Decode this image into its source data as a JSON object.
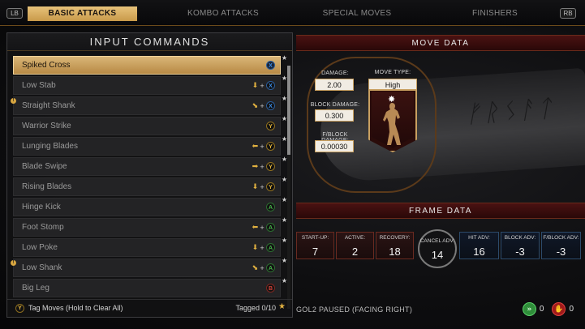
{
  "header": {
    "lb": "LB",
    "rb": "RB",
    "tabs": [
      "BASIC ATTACKS",
      "KOMBO ATTACKS",
      "SPECIAL MOVES",
      "FINISHERS"
    ]
  },
  "input_commands": {
    "title": "INPUT COMMANDS",
    "moves": [
      {
        "name": "Spiked Cross",
        "selected": true,
        "tagged": false,
        "cmd": {
          "arrow": "",
          "button": "X",
          "color": "x"
        }
      },
      {
        "name": "Low Stab",
        "selected": false,
        "tagged": false,
        "cmd": {
          "arrow": "⬇",
          "button": "X",
          "color": "x"
        }
      },
      {
        "name": "Straight Shank",
        "selected": false,
        "tagged": true,
        "cmd": {
          "arrow": "⬊",
          "button": "X",
          "color": "x"
        }
      },
      {
        "name": "Warrior Strike",
        "selected": false,
        "tagged": false,
        "cmd": {
          "arrow": "",
          "button": "Y",
          "color": "y"
        }
      },
      {
        "name": "Lunging Blades",
        "selected": false,
        "tagged": false,
        "cmd": {
          "arrow": "⬅",
          "button": "Y",
          "color": "y"
        }
      },
      {
        "name": "Blade Swipe",
        "selected": false,
        "tagged": false,
        "cmd": {
          "arrow": "➡",
          "button": "Y",
          "color": "y"
        }
      },
      {
        "name": "Rising Blades",
        "selected": false,
        "tagged": false,
        "cmd": {
          "arrow": "⬇",
          "button": "Y",
          "color": "y"
        }
      },
      {
        "name": "Hinge Kick",
        "selected": false,
        "tagged": false,
        "cmd": {
          "arrow": "",
          "button": "A",
          "color": "a"
        }
      },
      {
        "name": "Foot Stomp",
        "selected": false,
        "tagged": false,
        "cmd": {
          "arrow": "⬅",
          "button": "A",
          "color": "a"
        }
      },
      {
        "name": "Low Poke",
        "selected": false,
        "tagged": false,
        "cmd": {
          "arrow": "⬇",
          "button": "A",
          "color": "a"
        }
      },
      {
        "name": "Low Shank",
        "selected": false,
        "tagged": true,
        "cmd": {
          "arrow": "⬊",
          "button": "A",
          "color": "a"
        }
      },
      {
        "name": "Big Leg",
        "selected": false,
        "tagged": false,
        "cmd": {
          "arrow": "",
          "button": "B",
          "color": "b"
        }
      }
    ],
    "footer": {
      "button": "Y",
      "label": "Tag Moves (Hold to Clear All)",
      "tagged": "Tagged 0/10"
    }
  },
  "move_data": {
    "title": "MOVE DATA",
    "damage_label": "DAMAGE:",
    "damage": "2.00",
    "block_damage_label": "BLOCK DAMAGE:",
    "block_damage": "0.300",
    "fblock_damage_label": "F/BLOCK DAMAGE:",
    "fblock_damage": "0.00030",
    "move_type_label": "MOVE TYPE:",
    "move_type": "High"
  },
  "frame_data": {
    "title": "FRAME DATA",
    "startup_label": "START-UP:",
    "startup": "7",
    "active_label": "ACTIVE:",
    "active": "2",
    "recovery_label": "RECOVERY:",
    "recovery": "18",
    "cancel_label": "CANCEL ADV:",
    "cancel": "14",
    "hit_label": "HIT ADV:",
    "hit": "16",
    "block_label": "BLOCK ADV:",
    "block": "-3",
    "fblock_label": "F/BLOCK ADV:",
    "fblock": "-3"
  },
  "status": "GOL2 PAUSED (FACING RIGHT)",
  "bottom_counts": {
    "green": "0",
    "red": "0"
  },
  "colors": {
    "accent_gold": "#d9b577",
    "header_red": "#4a1212",
    "hit_blue": "#2c4a6a"
  }
}
